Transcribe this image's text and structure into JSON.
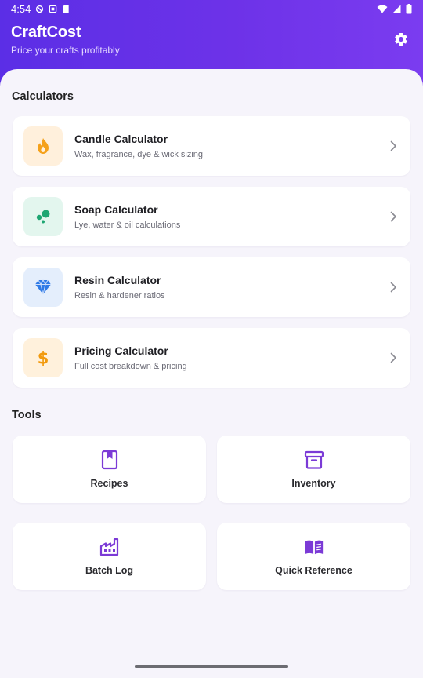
{
  "status_bar": {
    "time": "4:54"
  },
  "header": {
    "title": "CraftCost",
    "subtitle": "Price your crafts profitably",
    "settings_icon": "gear-icon"
  },
  "colors": {
    "header_gradient_start": "#5b2ee6",
    "header_gradient_end": "#7b3cf0",
    "accent_purple": "#6d32e8",
    "candle_bg": "#fff0dc",
    "soap_bg": "#e3f6ee",
    "resin_bg": "#e4eefc",
    "pricing_bg": "#fff1dc"
  },
  "sections": {
    "calculators_title": "Calculators",
    "tools_title": "Tools"
  },
  "calculators": [
    {
      "title": "Candle Calculator",
      "description": "Wax, fragrance, dye & wick sizing",
      "icon": "flame-icon"
    },
    {
      "title": "Soap Calculator",
      "description": "Lye, water & oil calculations",
      "icon": "bubbles-icon"
    },
    {
      "title": "Resin Calculator",
      "description": "Resin & hardener ratios",
      "icon": "diamond-icon"
    },
    {
      "title": "Pricing Calculator",
      "description": "Full cost breakdown & pricing",
      "icon": "dollar-icon"
    }
  ],
  "tools": [
    {
      "label": "Recipes",
      "icon": "book-bookmark-icon"
    },
    {
      "label": "Inventory",
      "icon": "archive-box-icon"
    },
    {
      "label": "Batch Log",
      "icon": "factory-icon"
    },
    {
      "label": "Quick Reference",
      "icon": "open-book-icon"
    }
  ]
}
